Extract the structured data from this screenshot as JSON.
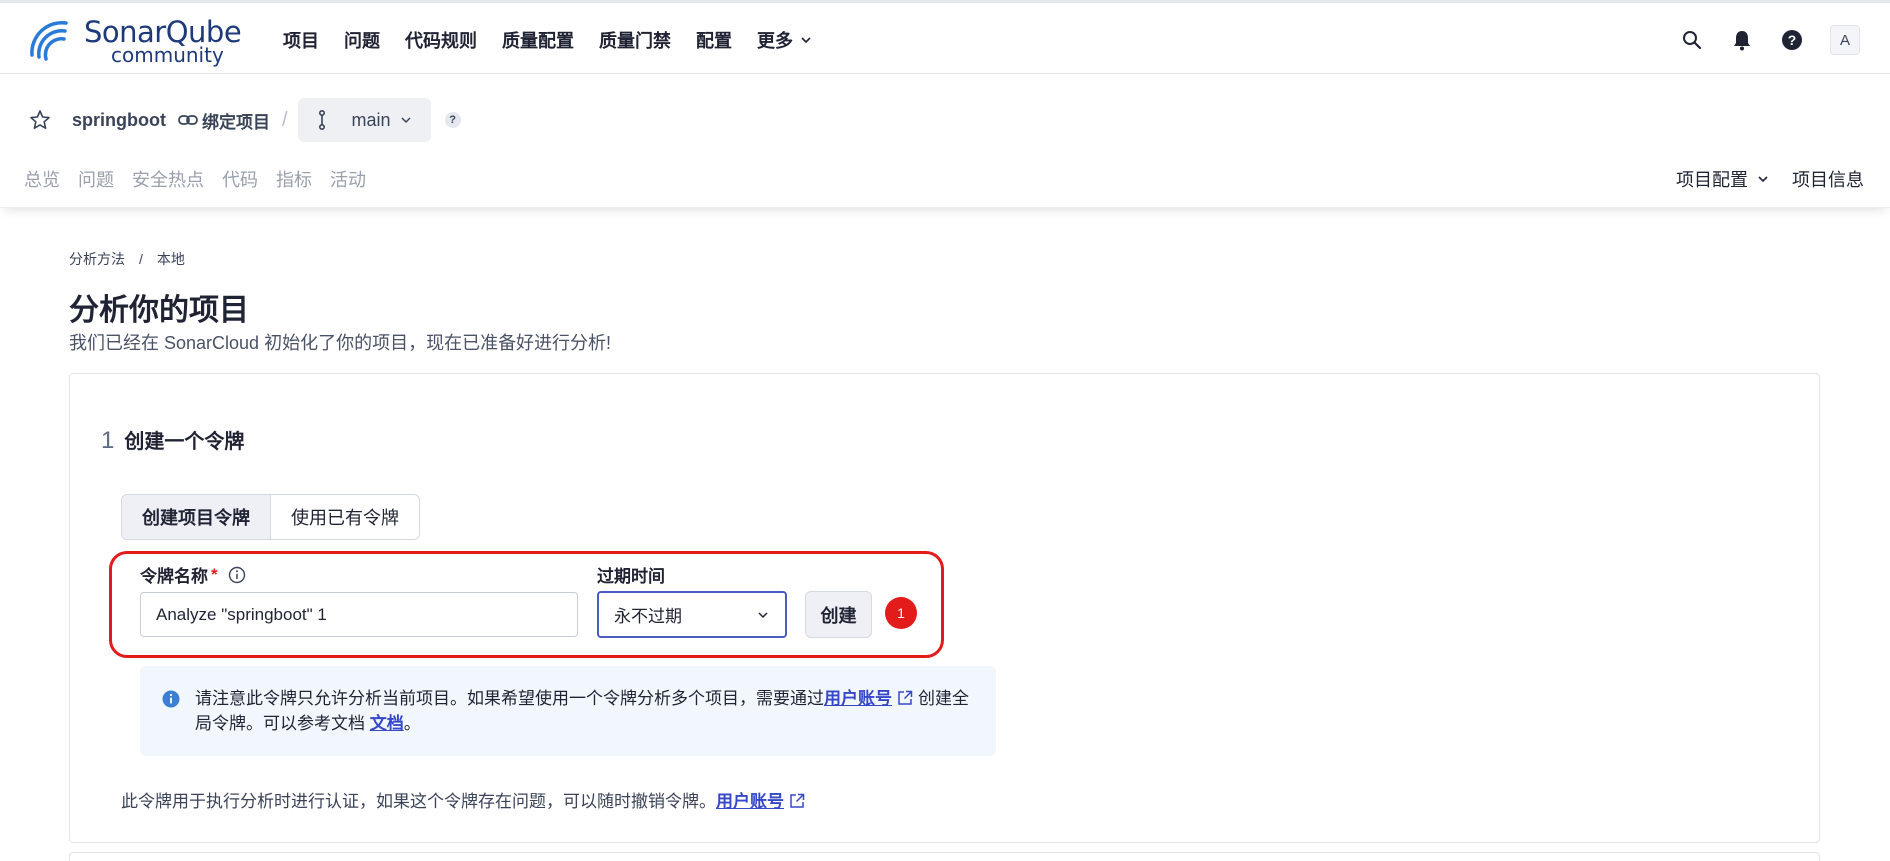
{
  "brand": {
    "name": "SonarQube",
    "edition": "community"
  },
  "nav": {
    "items": [
      "项目",
      "问题",
      "代码规则",
      "质量配置",
      "质量门禁",
      "配置"
    ],
    "more": "更多",
    "avatar": "A"
  },
  "project": {
    "name": "springboot",
    "bind_label": "绑定项目",
    "branch": "main",
    "help": "?"
  },
  "tabs": [
    "总览",
    "问题",
    "安全热点",
    "代码",
    "指标",
    "活动"
  ],
  "right_tabs": {
    "config": "项目配置",
    "info": "项目信息"
  },
  "page": {
    "breadcrumb": [
      "分析方法",
      "本地"
    ],
    "title": "分析你的项目",
    "subtitle": "我们已经在 SonarCloud 初始化了你的项目，现在已准备好进行分析!"
  },
  "step": {
    "number": "1",
    "title": "创建一个令牌",
    "toggle": [
      "创建项目令牌",
      "使用已有令牌"
    ],
    "token_label": "令牌名称",
    "required_mark": "*",
    "token_value": "Analyze \"springboot\" 1",
    "expiry_label": "过期时间",
    "expiry_value": "永不过期",
    "create_button": "创建",
    "badge": "1",
    "note_a": "请注意此令牌只允许分析当前项目。如果希望使用一个令牌分析多个项目，需要通过",
    "note_link1": "用户账号",
    "note_b": "创建全局令牌。可以参考文档",
    "note_link2": "文档",
    "note_end": "。",
    "footer_text": "此令牌用于执行分析时进行认证，如果这个令牌存在问题，可以随时撤销令牌。",
    "footer_link": "用户账号"
  },
  "colors": {
    "accent": "#3648c9",
    "highlight": "#e31b1b",
    "logo": "#1e3a7b",
    "info_bg": "#f2f7fd"
  }
}
